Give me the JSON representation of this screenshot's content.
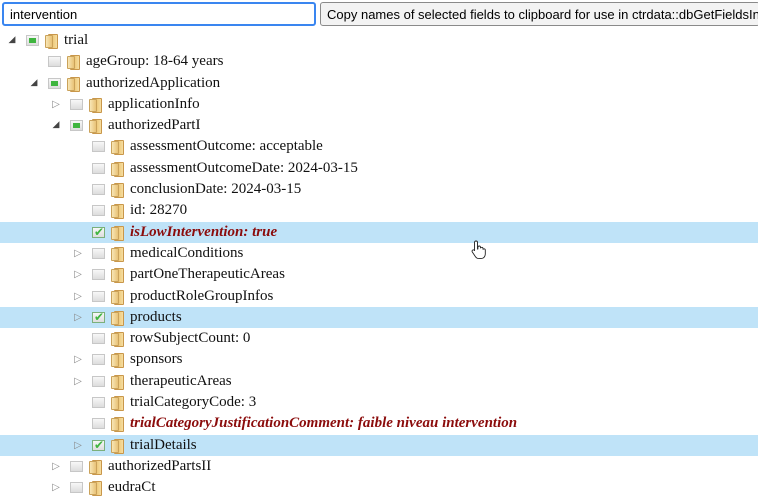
{
  "search": {
    "value": "intervention"
  },
  "copy_button": {
    "label": "Copy names of selected fields to clipboard for use in ctrdata::dbGetFieldsIntoDf()"
  },
  "tree": [
    {
      "label": "trial",
      "level": 0,
      "expander": "open",
      "checkbox": "partial",
      "selected": false,
      "highlight": false
    },
    {
      "label": "ageGroup: 18-64 years",
      "level": 1,
      "expander": "none",
      "checkbox": "unchecked",
      "selected": false,
      "highlight": false
    },
    {
      "label": "authorizedApplication",
      "level": 1,
      "expander": "open",
      "checkbox": "partial",
      "selected": false,
      "highlight": false
    },
    {
      "label": "applicationInfo",
      "level": 2,
      "expander": "closed",
      "checkbox": "unchecked",
      "selected": false,
      "highlight": false
    },
    {
      "label": "authorizedPartI",
      "level": 2,
      "expander": "open",
      "checkbox": "partial",
      "selected": false,
      "highlight": false
    },
    {
      "label": "assessmentOutcome: acceptable",
      "level": 3,
      "expander": "none",
      "checkbox": "unchecked",
      "selected": false,
      "highlight": false
    },
    {
      "label": "assessmentOutcomeDate: 2024-03-15",
      "level": 3,
      "expander": "none",
      "checkbox": "unchecked",
      "selected": false,
      "highlight": false
    },
    {
      "label": "conclusionDate: 2024-03-15",
      "level": 3,
      "expander": "none",
      "checkbox": "unchecked",
      "selected": false,
      "highlight": false
    },
    {
      "label": "id: 28270",
      "level": 3,
      "expander": "none",
      "checkbox": "unchecked",
      "selected": false,
      "highlight": false
    },
    {
      "label": "isLowIntervention: true",
      "level": 3,
      "expander": "none",
      "checkbox": "checked",
      "selected": true,
      "highlight": true
    },
    {
      "label": "medicalConditions",
      "level": 3,
      "expander": "closed",
      "checkbox": "unchecked",
      "selected": false,
      "highlight": false
    },
    {
      "label": "partOneTherapeuticAreas",
      "level": 3,
      "expander": "closed",
      "checkbox": "unchecked",
      "selected": false,
      "highlight": false
    },
    {
      "label": "productRoleGroupInfos",
      "level": 3,
      "expander": "closed",
      "checkbox": "unchecked",
      "selected": false,
      "highlight": false
    },
    {
      "label": "products",
      "level": 3,
      "expander": "closed",
      "checkbox": "checked",
      "selected": true,
      "highlight": false
    },
    {
      "label": "rowSubjectCount: 0",
      "level": 3,
      "expander": "none",
      "checkbox": "unchecked",
      "selected": false,
      "highlight": false
    },
    {
      "label": "sponsors",
      "level": 3,
      "expander": "closed",
      "checkbox": "unchecked",
      "selected": false,
      "highlight": false
    },
    {
      "label": "therapeuticAreas",
      "level": 3,
      "expander": "closed",
      "checkbox": "unchecked",
      "selected": false,
      "highlight": false
    },
    {
      "label": "trialCategoryCode: 3",
      "level": 3,
      "expander": "none",
      "checkbox": "unchecked",
      "selected": false,
      "highlight": false
    },
    {
      "label": "trialCategoryJustificationComment: faible niveau intervention",
      "level": 3,
      "expander": "none",
      "checkbox": "unchecked",
      "selected": false,
      "highlight": true
    },
    {
      "label": "trialDetails",
      "level": 3,
      "expander": "closed",
      "checkbox": "checked",
      "selected": true,
      "highlight": false
    },
    {
      "label": "authorizedPartsII",
      "level": 2,
      "expander": "closed",
      "checkbox": "unchecked",
      "selected": false,
      "highlight": false
    },
    {
      "label": "eudraCt",
      "level": 2,
      "expander": "closed",
      "checkbox": "unchecked",
      "selected": false,
      "highlight": false
    }
  ],
  "icons": {
    "expander_open": "triangle-down-icon",
    "expander_closed": "triangle-right-icon",
    "folder": "folder-icon",
    "cursor": "hand-pointer-icon"
  },
  "colors": {
    "selected_row": "#bfe3f8",
    "highlight_text": "#8b0c0c",
    "check_green": "#3fb53f",
    "search_border": "#3a86f0"
  }
}
